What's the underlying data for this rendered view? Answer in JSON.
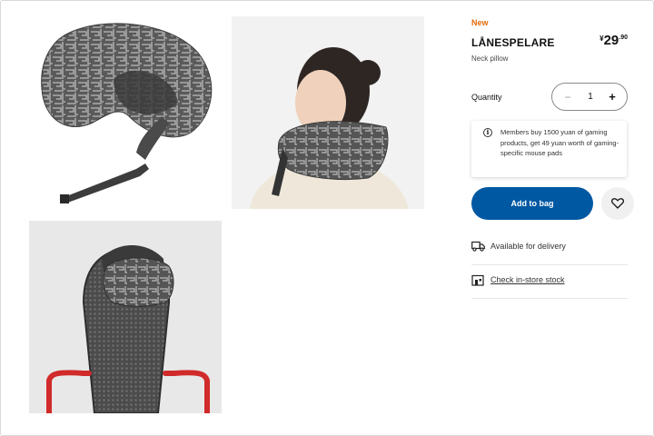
{
  "product": {
    "badge": "New",
    "name": "LÅNESPELARE",
    "description": "Neck pillow",
    "price": {
      "currency": "¥",
      "integer": "29",
      "decimal": ".90"
    }
  },
  "quantity": {
    "label": "Quantity",
    "value": "1",
    "minus": "−",
    "plus": "+"
  },
  "promo": {
    "icon": "info-icon",
    "text": "Members buy 1500 yuan of gaming products, get 49 yuan worth of gaming-specific mouse pads"
  },
  "actions": {
    "add_to_bag": "Add to bag",
    "favourite_icon": "heart-icon"
  },
  "availability": {
    "delivery": {
      "icon": "truck-icon",
      "label": "Available for delivery"
    },
    "store": {
      "icon": "store-icon",
      "label": "Check in-store stock"
    }
  },
  "gallery": {
    "images": [
      "neck-pillow-product",
      "neck-pillow-worn-by-model",
      "neck-pillow-on-gaming-chair"
    ]
  },
  "colors": {
    "accent": "#0058a3",
    "new_badge": "#e36c0a",
    "chair_frame": "#d12a2a"
  }
}
